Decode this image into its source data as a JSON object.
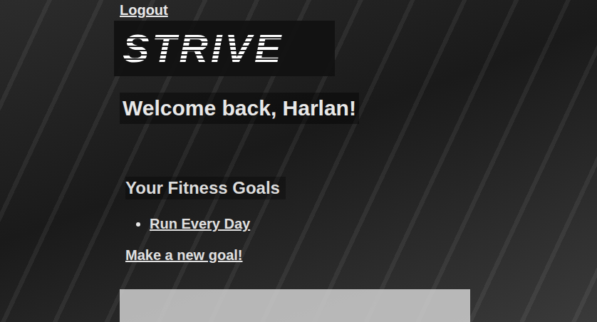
{
  "nav": {
    "logout": "Logout"
  },
  "logo": "STRIVE",
  "welcome": "Welcome back, Harlan!",
  "goals": {
    "title": "Your Fitness Goals",
    "items": [
      {
        "label": "Run Every Day"
      }
    ],
    "new_goal": "Make a new goal!"
  }
}
